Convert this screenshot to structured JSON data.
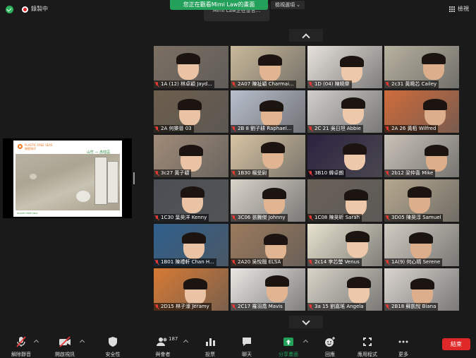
{
  "topbar": {
    "recording_label": "錄製中",
    "viewing_banner": "您正在觀看Mimi Law的畫面",
    "view_options": "檢視選項 ⌄",
    "speaking_label": "Mimi Law正在發言...",
    "view_label": "檢視"
  },
  "share": {
    "brand": "PLASTIC FREE SEAS 無塑海洋",
    "slide_title": "山竹 — 赤柱區",
    "slide_footer": "PLASTIC FREE SEAS"
  },
  "participants": [
    {
      "name": "1A (12) 林卓穎 Jayd...",
      "bg": "#7c6f63"
    },
    {
      "name": "2A07 陳祉穎 Charmai...",
      "bg": "#c9b99a"
    },
    {
      "name": "1D (04) 陳曉樂",
      "bg": "#e7e2dc"
    },
    {
      "name": "2c31 黃曉芯 Cailey",
      "bg": "#b7b19f"
    },
    {
      "name": "2A 何樂晉 03",
      "bg": "#6d5e4c"
    },
    {
      "name": "2B 8 劉子耕 Raphael...",
      "bg": "#b8bfcc"
    },
    {
      "name": "2C 21 吳日坦 Abbie",
      "bg": "#d1cfcc"
    },
    {
      "name": "2A 26 黃栢 Wilfred",
      "bg": "#cf6c3c"
    },
    {
      "name": "3c27 黃子穎",
      "bg": "#a08b78"
    },
    {
      "name": "1B30 楊旻尉",
      "bg": "#d8c4a3"
    },
    {
      "name": "3B10 韓卓朗",
      "bg": "#2b2340"
    },
    {
      "name": "2b12 梁仲喜 Mike",
      "bg": "#c9c2b8"
    },
    {
      "name": "1C30 葉昊洋 Kenny",
      "bg": "#4b4f55"
    },
    {
      "name": "3C06 張騰傑 Johnny",
      "bg": "#d9d4ca"
    },
    {
      "name": "1C08 陳昊昕 Sarah",
      "bg": "#6a6258"
    },
    {
      "name": "3D05 陳昊淳 Samuel",
      "bg": "#b6a88f"
    },
    {
      "name": "1B01 陳禮軒 Chan H...",
      "bg": "#2f5f8c"
    },
    {
      "name": "2A20 吳悅翹 ELSA",
      "bg": "#9b7a5c"
    },
    {
      "name": "2c14 李芯瑩 Venus",
      "bg": "#e8e3cf"
    },
    {
      "name": "1A(9) 何心晴 Serene",
      "bg": "#d2ccc2"
    },
    {
      "name": "2D15 林子濠 Jeramy",
      "bg": "#d67a34"
    },
    {
      "name": "2C17 羅羽喬 Mavis",
      "bg": "#e9e7e2"
    },
    {
      "name": "3a 15 劉嘉瑤 Angela",
      "bg": "#d7d3c8"
    },
    {
      "name": "2B18 蘇凱悅 Biana",
      "bg": "#d9d4cf"
    }
  ],
  "toolbar": {
    "unmute": "解除靜音",
    "start_video": "開啟視訊",
    "security": "安全性",
    "participants": "與會者",
    "participant_count": "187",
    "polls": "投票",
    "chat": "聊天",
    "share_screen": "分享畫面",
    "reactions": "回應",
    "apps": "應用程式",
    "more": "更多",
    "end": "結束"
  },
  "colors": {
    "share_green": "#23a05a",
    "end_red": "#e02828",
    "muted_red": "#e53935"
  }
}
